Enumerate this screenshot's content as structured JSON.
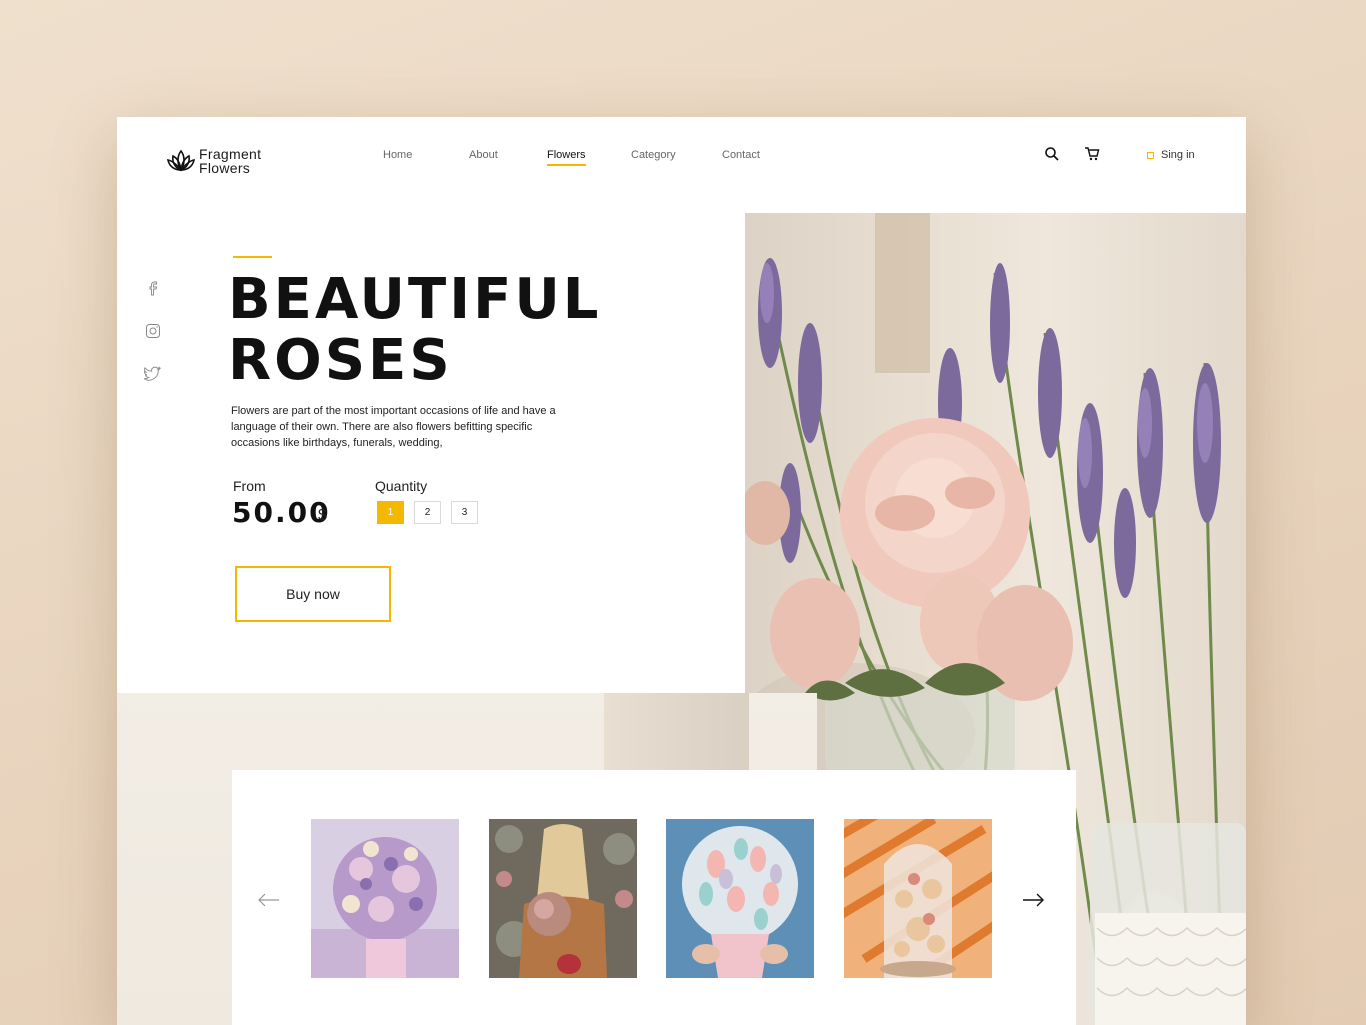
{
  "brand": {
    "name_line1": "Fragment",
    "name_line2": "Flowers"
  },
  "nav": {
    "items": [
      {
        "label": "Home"
      },
      {
        "label": "About"
      },
      {
        "label": "Flowers"
      },
      {
        "label": "Category"
      },
      {
        "label": "Contact"
      }
    ],
    "active": "Flowers"
  },
  "header": {
    "search_icon": "search-icon",
    "cart_icon": "cart-icon",
    "signin_label": "Sing in"
  },
  "social": [
    "facebook-icon",
    "instagram-icon",
    "twitter-icon"
  ],
  "hero": {
    "title_line1": "BEAUTIFUL",
    "title_line2": "ROSES",
    "description": "Flowers are part of the most important occasions of life and have a language of their own. There are also flowers befitting specific occasions like birthdays, funerals, wedding,",
    "from_label": "From",
    "price": "50.00",
    "currency": "$",
    "quantity_label": "Quantity",
    "quantity_options": [
      "1",
      "2",
      "3"
    ],
    "quantity_selected": "1",
    "buy_label": "Buy now"
  },
  "carousel": {
    "prev_icon": "arrow-left-icon",
    "next_icon": "arrow-right-icon",
    "items": [
      "dried-flower-bouquet",
      "woman-holding-bouquet",
      "pastel-bouquet-pot",
      "flowers-in-glass-dome"
    ]
  },
  "colors": {
    "accent": "#f5b800",
    "text": "#111111",
    "background": "#efe0cd"
  }
}
